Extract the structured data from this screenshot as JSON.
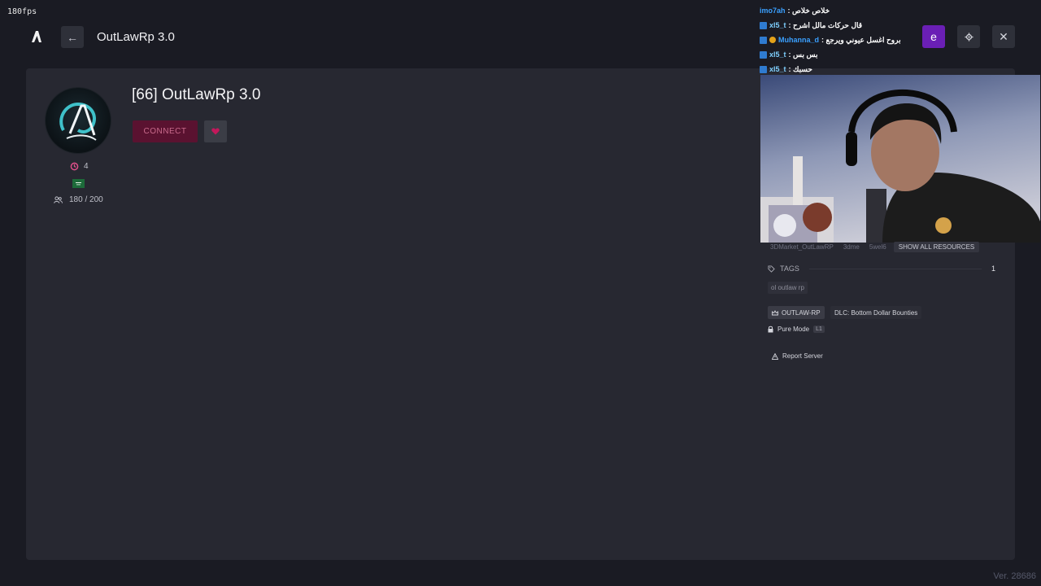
{
  "overlay": {
    "fps": "180fps",
    "version": "Ver. 28686"
  },
  "header": {
    "title": "OutLawRp 3.0",
    "back_icon": "←",
    "user_initial": "e"
  },
  "server": {
    "title": "[66] OutLawRp 3.0",
    "connect_label": "CONNECT",
    "boosts": "4",
    "flag_label": "SA",
    "players": "180 / 200"
  },
  "chat": [
    {
      "name": "imo7ah",
      "name_color": "#3aa0ff",
      "msg": ": خلاص خلاص",
      "badge": false
    },
    {
      "name": "xl5_t",
      "name_color": "#7fd0ff",
      "msg": ": قال حركات مالل اشرح",
      "badge": true
    },
    {
      "name": "Muhanna_d",
      "name_color": "#3aa0ff",
      "msg": ": بروح اغسل عيوني ويرجع",
      "badge": true
    },
    {
      "name": "xl5_t",
      "name_color": "#7fd0ff",
      "msg": ": بس بس",
      "badge": true
    },
    {
      "name": "xl5_t",
      "name_color": "#7fd0ff",
      "msg": ": حسبك",
      "badge": true
    }
  ],
  "resources": {
    "items": [
      "3DMarket_OutLawRP",
      "3dme",
      "5wel6"
    ],
    "show_all": "SHOW ALL RESOURCES"
  },
  "tags": {
    "label": "TAGS",
    "count": "1",
    "items": [
      "ol outlaw rp"
    ]
  },
  "chips": {
    "outlaw": "OUTLAW-RP",
    "dlc": "DLC: Bottom Dollar Bounties",
    "pure_mode": "Pure Mode",
    "pure_level": "L1",
    "report": "Report Server"
  },
  "colors": {
    "background": "#1a1b23",
    "panel": "#272831",
    "connect_bg": "#5a1230",
    "user_accent": "#6a1fb5"
  }
}
